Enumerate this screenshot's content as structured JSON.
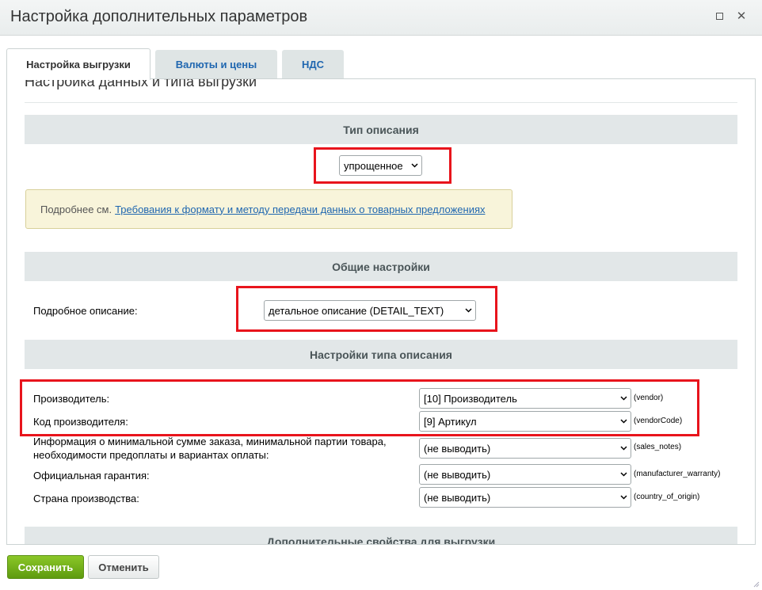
{
  "window": {
    "title": "Настройка дополнительных параметров"
  },
  "tabs": [
    {
      "label": "Настройка выгрузки",
      "active": true
    },
    {
      "label": "Валюты и цены",
      "active": false
    },
    {
      "label": "НДС",
      "active": false
    }
  ],
  "panel": {
    "section_title": "Настройка данных и типа выгрузки",
    "description_type": {
      "header": "Тип описания",
      "selected": "упрощенное"
    },
    "note": {
      "prefix": "Подробнее см.",
      "link": "Требования к формату и методу передачи данных о товарных предложениях"
    },
    "general": {
      "header": "Общие настройки",
      "detail_label": "Подробное описание:",
      "detail_selected": "детальное описание (DETAIL_TEXT)"
    },
    "type_settings": {
      "header": "Настройки типа описания",
      "rows": [
        {
          "label": "Производитель:",
          "selected": "[10] Производитель",
          "code": "(vendor)"
        },
        {
          "label": "Код производителя:",
          "selected": "[9] Артикул",
          "code": "(vendorCode)"
        },
        {
          "label": "Информация о минимальной сумме заказа, минимальной партии товара, необходимости предоплаты и вариантах оплаты:",
          "selected": "(не выводить)",
          "code": "(sales_notes)"
        },
        {
          "label": "Официальная гарантия:",
          "selected": "(не выводить)",
          "code": "(manufacturer_warranty)"
        },
        {
          "label": "Страна производства:",
          "selected": "(не выводить)",
          "code": "(country_of_origin)"
        }
      ]
    },
    "extra": {
      "header": "Дополнительные свойства для выгрузки"
    }
  },
  "buttons": {
    "save": "Сохранить",
    "cancel": "Отменить"
  },
  "colors": {
    "highlight": "#e8141c",
    "link": "#2067b0",
    "save_button": "#6fae14"
  },
  "icons": {
    "maximize": "maximize-icon",
    "close": "close-icon",
    "dropdown": "chevron-down-icon"
  }
}
